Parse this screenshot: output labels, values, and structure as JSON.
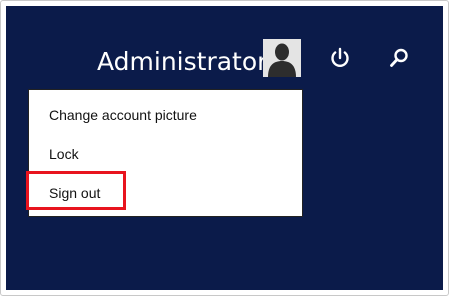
{
  "user": {
    "name": "Administrator",
    "avatar_icon": "user-silhouette-icon"
  },
  "top_bar": {
    "power_icon": "power-icon",
    "search_icon": "search-icon"
  },
  "account_menu": {
    "items": [
      {
        "label": "Change account picture"
      },
      {
        "label": "Lock"
      },
      {
        "label": "Sign out"
      }
    ]
  },
  "colors": {
    "background": "#0b1b4a",
    "highlight": "#e8141e",
    "menu_background": "#ffffff"
  }
}
